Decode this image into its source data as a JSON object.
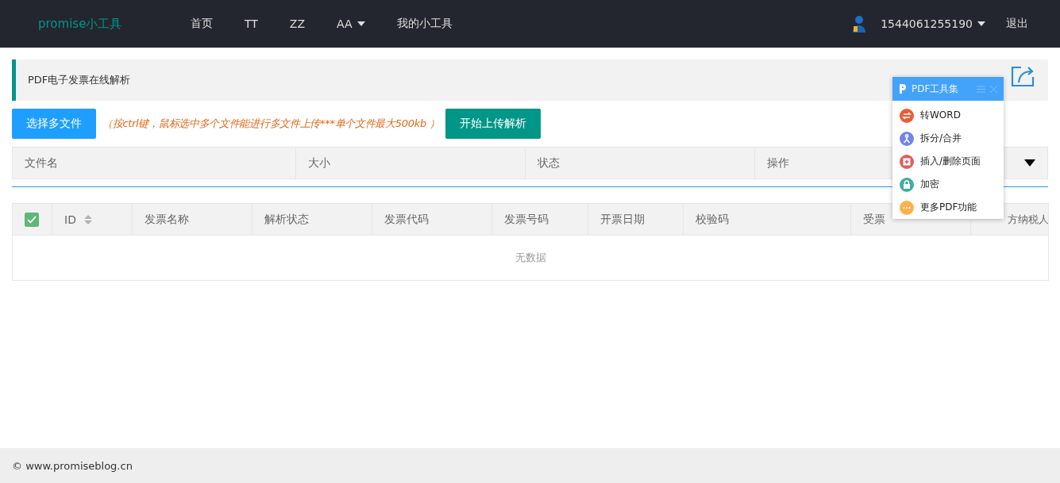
{
  "navbar": {
    "logo": "promise小工具",
    "items": [
      {
        "label": "首页",
        "dropdown": false
      },
      {
        "label": "TT",
        "dropdown": false
      },
      {
        "label": "ZZ",
        "dropdown": false
      },
      {
        "label": "AA",
        "dropdown": true
      },
      {
        "label": "我的小工具",
        "dropdown": false
      }
    ],
    "user": {
      "name": "1544061255190",
      "dropdown": true
    },
    "logout": "退出"
  },
  "notice": "PDF电子发票在线解析",
  "upload": {
    "select_button": "选择多文件",
    "hint": "（按ctrl键，鼠标选中多个文件能进行多文件上传***单个文件最大500kb ）",
    "start_button": "开始上传解析"
  },
  "file_table": {
    "columns": [
      "文件名",
      "大小",
      "状态",
      "操作"
    ]
  },
  "invoice_table": {
    "select_all_checked": true,
    "columns": [
      {
        "label": "ID",
        "sortable": true
      },
      {
        "label": "发票名称",
        "sortable": false
      },
      {
        "label": "解析状态",
        "sortable": false
      },
      {
        "label": "发票代码",
        "sortable": false
      },
      {
        "label": "发票号码",
        "sortable": false
      },
      {
        "label": "开票日期",
        "sortable": false
      },
      {
        "label": "校验码",
        "sortable": false
      },
      {
        "label": "受票",
        "sortable": false
      },
      {
        "label": "方纳税人",
        "sortable": false
      }
    ],
    "empty_text": "无数据"
  },
  "pdf_toolbox": {
    "title": "PDF工具集",
    "items": [
      {
        "label": "转WORD",
        "kind": "convert",
        "color": "#ee5a35"
      },
      {
        "label": "拆分/合并",
        "kind": "split",
        "color": "#6f86e8"
      },
      {
        "label": "插入/删除页面",
        "kind": "insert",
        "color": "#e45b5b"
      },
      {
        "label": "加密",
        "kind": "lock",
        "color": "#3fae9f"
      },
      {
        "label": "更多PDF功能",
        "kind": "more",
        "color": "#fbb14f"
      }
    ]
  },
  "footer": "© www.promiseblog.cn"
}
